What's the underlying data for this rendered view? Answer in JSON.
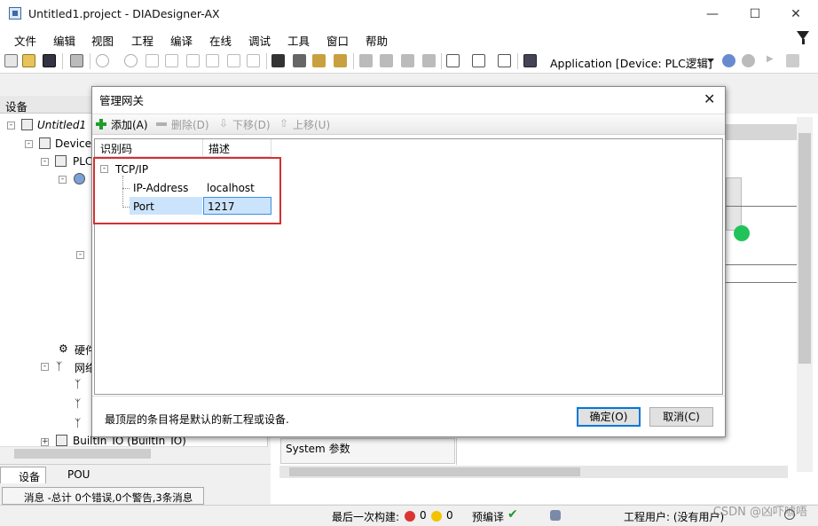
{
  "window": {
    "title": "Untitled1.project - DIADesigner-AX"
  },
  "menu": [
    "文件",
    "编辑",
    "视图",
    "工程",
    "编译",
    "在线",
    "调试",
    "工具",
    "窗口",
    "帮助"
  ],
  "toolbar": {
    "application_selector": "Application [Device: PLC逻辑]"
  },
  "devices_panel": {
    "title": "设备",
    "tree": [
      {
        "label": "Untitled1"
      },
      {
        "label": "Device ("
      },
      {
        "label": "PLC"
      },
      {
        "label": "硬件"
      },
      {
        "label": "网络"
      },
      {
        "label": "BuiltIn_IO (BuiltIn_IO)"
      }
    ],
    "tabs": [
      "设备",
      "POU"
    ]
  },
  "messages": {
    "summary": "消息 -总计 0个错误,0个警告,3条消息"
  },
  "right_pane": {
    "system_params": "System 参数"
  },
  "status": {
    "last_build": "最后一次构建:",
    "errors": "0",
    "warnings": "0",
    "precompile": "预编译",
    "user": "工程用户: (没有用户)"
  },
  "dialog": {
    "title": "管理网关",
    "toolbar": {
      "add": "添加(A)",
      "delete": "删除(D)",
      "move_down": "下移(D)",
      "move_up": "上移(U)"
    },
    "columns": [
      "识别码",
      "描述"
    ],
    "tree": {
      "root": "TCP/IP",
      "rows": [
        {
          "key": "IP-Address",
          "value": "localhost"
        },
        {
          "key": "Port",
          "value": "1217"
        }
      ]
    },
    "hint": "最顶层的条目将是默认的新工程或设备.",
    "ok": "确定(O)",
    "cancel": "取消(C)"
  },
  "watermark": "CSDN @凶吓唬唔"
}
